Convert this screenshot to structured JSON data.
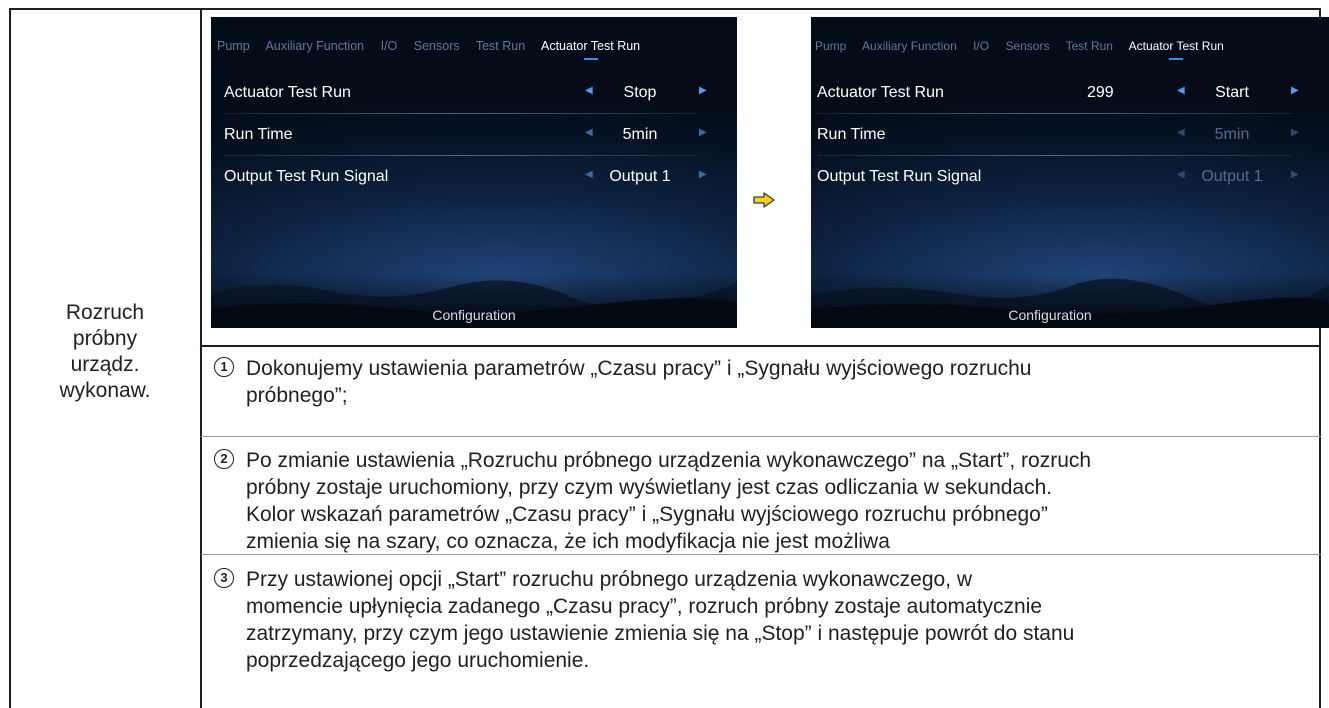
{
  "left_label": [
    "Rozruch",
    "próbny",
    "urządz.",
    "wykonaw."
  ],
  "screens": [
    {
      "tabs": [
        "Pump",
        "Auxiliary Function",
        "I/O",
        "Sensors",
        "Test Run",
        "Actuator Test Run"
      ],
      "active_tab": "Actuator Test Run",
      "rows": [
        {
          "label": "Actuator Test Run",
          "number": "",
          "value": "Stop",
          "dimmed": false
        },
        {
          "label": "Run Time",
          "number": "",
          "value": "5min",
          "dimmed": false
        },
        {
          "label": "Output Test Run Signal",
          "number": "",
          "value": "Output 1",
          "dimmed": false
        }
      ],
      "footer": "Configuration"
    },
    {
      "tabs": [
        "Pump",
        "Auxiliary Function",
        "I/O",
        "Sensors",
        "Test Run",
        "Actuator Test Run"
      ],
      "active_tab": "Actuator Test Run",
      "rows": [
        {
          "label": "Actuator Test Run",
          "number": "299",
          "value": "Start",
          "dimmed": false
        },
        {
          "label": "Run Time",
          "number": "",
          "value": "5min",
          "dimmed": true
        },
        {
          "label": "Output Test Run Signal",
          "number": "",
          "value": "Output 1",
          "dimmed": true
        }
      ],
      "footer": "Configuration"
    }
  ],
  "colors": {
    "arrow_fill": "#f3d21a",
    "accent_blue": "#3a97ea",
    "dim_text": "#56698a"
  },
  "steps": [
    {
      "n": "1",
      "lines": [
        "Dokonujemy ustawienia parametrów „Czasu pracy” i „Sygnału wyjściowego rozruchu",
        "próbnego”;"
      ]
    },
    {
      "n": "2",
      "lines": [
        "Po zmianie ustawienia „Rozruchu próbnego urządzenia wykonawczego” na „Start”, rozruch",
        "próbny zostaje uruchomiony, przy czym wyświetlany jest czas odliczania w sekundach.",
        "Kolor wskazań parametrów „Czasu pracy” i „Sygnału wyjściowego rozruchu próbnego”",
        "zmienia się na szary, co oznacza, że ich modyfikacja nie jest możliwa"
      ]
    },
    {
      "n": "3",
      "lines": [
        "Przy ustawionej opcji „Start” rozruchu próbnego urządzenia wykonawczego, w",
        "momencie upłynięcia zadanego „Czasu pracy”, rozruch próbny zostaje automatycznie",
        "zatrzymany, przy czym jego ustawienie zmienia się na „Stop” i następuje powrót do stanu",
        "poprzedzającego jego uruchomienie."
      ]
    }
  ]
}
